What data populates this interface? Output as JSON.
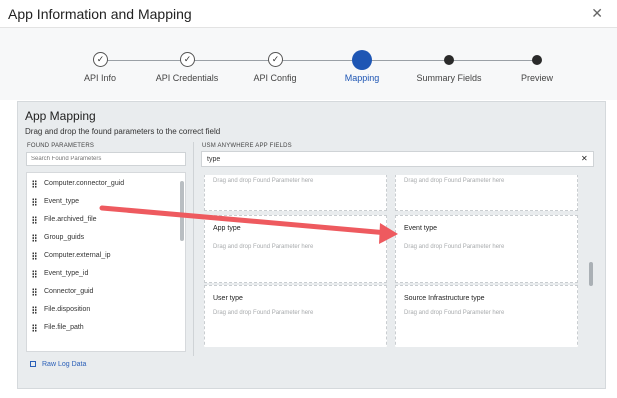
{
  "dialog": {
    "title": "App Information and Mapping",
    "close_glyph": "✕"
  },
  "wizard": {
    "steps": [
      {
        "label": "API Info",
        "state": "done"
      },
      {
        "label": "API Credentials",
        "state": "done"
      },
      {
        "label": "API Config",
        "state": "done"
      },
      {
        "label": "Mapping",
        "state": "active"
      },
      {
        "label": "Summary Fields",
        "state": "future"
      },
      {
        "label": "Preview",
        "state": "future"
      }
    ]
  },
  "mapping": {
    "title": "App Mapping",
    "subtitle": "Drag and drop the found parameters to the correct field",
    "found": {
      "heading": "FOUND PARAMETERS",
      "search_placeholder": "Search Found Parameters",
      "items": [
        "Computer.connector_guid",
        "Event_type",
        "File.archived_file",
        "Group_guids",
        "Computer.external_ip",
        "Event_type_id",
        "Connector_guid",
        "File.disposition",
        "File.file_path"
      ],
      "raw_log_label": "Raw Log Data"
    },
    "usm": {
      "heading": "USM ANYWHERE APP FIELDS",
      "search_value": "type",
      "clear_glyph": "✕",
      "drop_hint": "Drag and drop Found Parameter here",
      "fields": [
        "App type",
        "Event type",
        "User type",
        "Source Infrastructure type"
      ]
    }
  },
  "colors": {
    "accent": "#1e56b4",
    "arrow": "#ee5a5f"
  }
}
